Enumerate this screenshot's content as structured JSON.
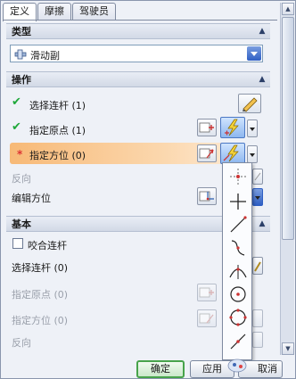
{
  "tabs": [
    "定义",
    "摩擦",
    "驾驶员"
  ],
  "sections": {
    "type": {
      "title": "类型",
      "selected": "滑动副",
      "icon": "slider-joint-icon"
    },
    "operation": {
      "title": "操作",
      "select_link": "选择连杆 (1)",
      "specify_origin": "指定原点 (1)",
      "specify_orientation": "指定方位 (0)",
      "reverse": "反向",
      "edit_orientation": "编辑方位"
    },
    "basic": {
      "title": "基本",
      "snap_link": "咬合连杆",
      "select_link": "选择连杆 (0)",
      "specify_origin": "指定原点 (0)",
      "specify_orientation": "指定方位 (0)",
      "reverse": "反向"
    }
  },
  "footer": {
    "ok": "确定",
    "apply": "应用",
    "cancel": "取消"
  },
  "flyout_icons": [
    "point-cross-icon",
    "plus-icon",
    "line-icon",
    "curve-icon",
    "arc-icon",
    "circle-center-icon",
    "circle-quadrant-icon",
    "line-point-icon"
  ],
  "colors": {
    "highlight": "#f7b977",
    "check": "#1fa83a",
    "required": "#dd3333",
    "accent_blue": "#2f5fc4"
  }
}
